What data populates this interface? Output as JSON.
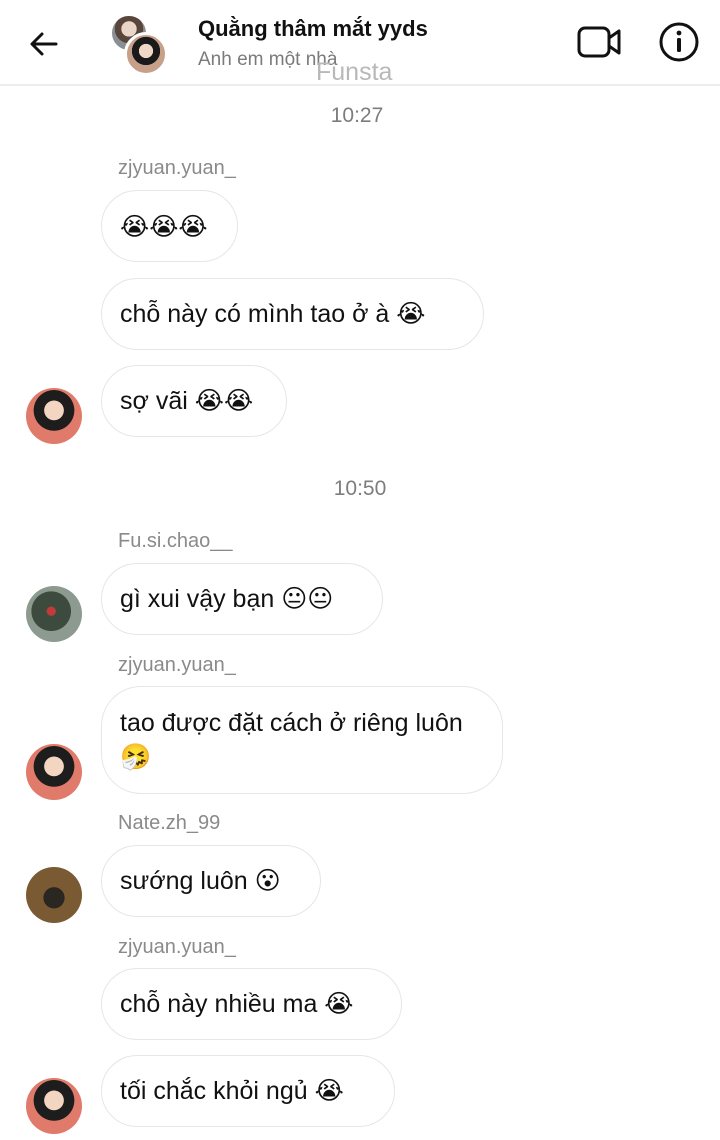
{
  "header": {
    "title": "Quằng thâm mắt yyds",
    "subtitle": "Anh em một nhà",
    "watermark": "Funsta",
    "icons": {
      "back": "arrow-left-icon",
      "video": "video-camera-icon",
      "info": "info-icon"
    }
  },
  "messages": {
    "time1": "10:27",
    "sender1": "zjyuan.yuan_",
    "m1": "😭😭😭",
    "m2": "chỗ này có mình tao ở à 😭",
    "m3": "sợ vãi 😭😭",
    "time2": "10:50",
    "sender2": "Fu.si.chao__",
    "m4": "gì xui vậy bạn 😐😐",
    "sender3": "zjyuan.yuan_",
    "m5": "tao được đặt cách ở riêng luôn 🤧",
    "sender4": "Nate.zh_99",
    "m6": "sướng luôn 😮",
    "sender5": "zjyuan.yuan_",
    "m7": "chỗ này nhiều ma 😭",
    "m8": "tối chắc khỏi ngủ 😭"
  },
  "colors": {
    "bubble_border": "#e6e6e6",
    "meta_text": "#8a8a8a",
    "header_border": "#ececec"
  }
}
